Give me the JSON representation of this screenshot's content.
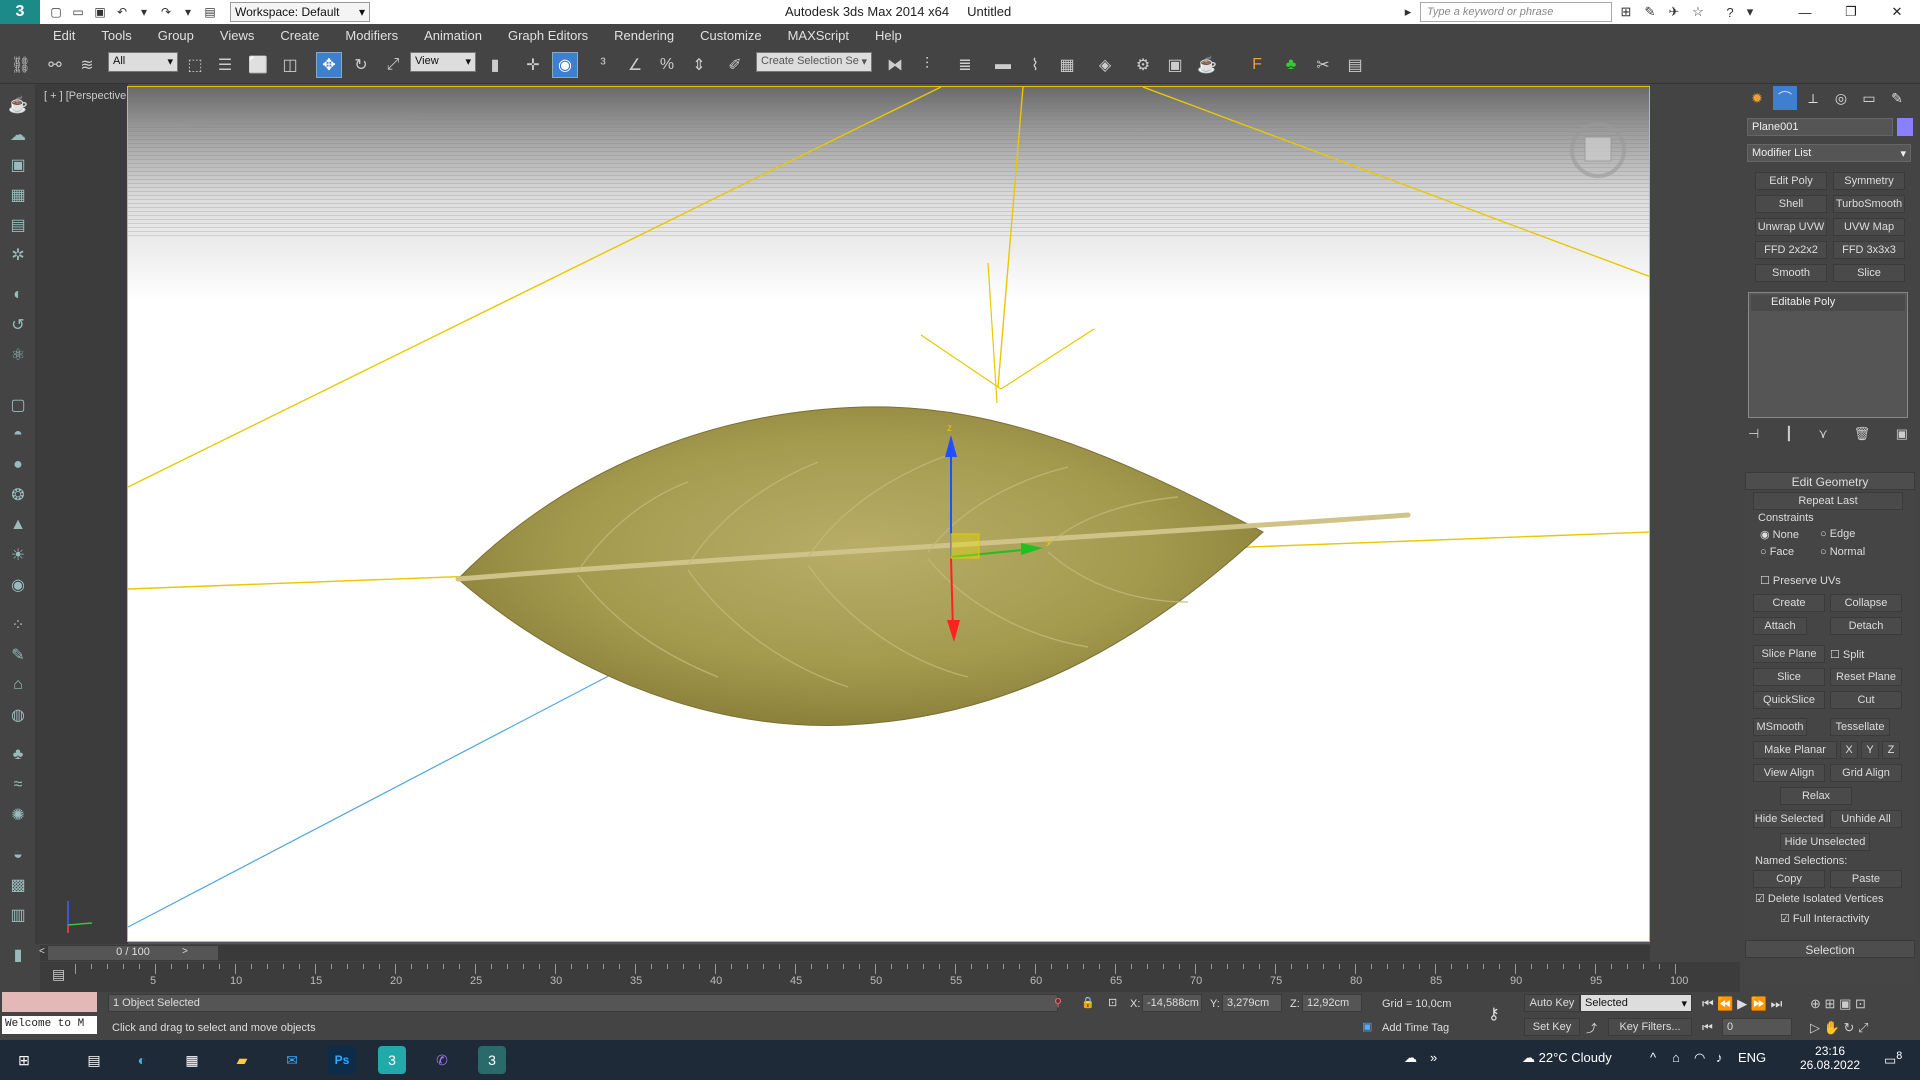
{
  "window": {
    "title": "Autodesk 3ds Max  2014 x64",
    "document": "Untitled",
    "workspace": "Workspace: Default",
    "search_placeholder": "Type a keyword or phrase"
  },
  "menu": [
    "Edit",
    "Tools",
    "Group",
    "Views",
    "Create",
    "Modifiers",
    "Animation",
    "Graph Editors",
    "Rendering",
    "Customize",
    "MAXScript",
    "Help"
  ],
  "toolbar": {
    "selection_filter": "All",
    "ref_coord": "View",
    "named_selection_placeholder": "Create Selection Se"
  },
  "viewport": {
    "label": "[ + ] [Perspective ] [Shaded + Edged Faces ]",
    "axis_x": "x",
    "axis_y": "y",
    "axis_z": "z"
  },
  "command_panel": {
    "object_name": "Plane001",
    "modifier_list": "Modifier List",
    "modifier_buttons": [
      "Edit Poly",
      "Symmetry",
      "Shell",
      "TurboSmooth",
      "Unwrap UVW",
      "UVW Map",
      "FFD 2x2x2",
      "FFD 3x3x3",
      "Smooth",
      "Slice"
    ],
    "stack_item": "Editable Poly"
  },
  "edit_geometry": {
    "title": "Edit Geometry",
    "repeat_last": "Repeat Last",
    "constraints": "Constraints",
    "none": "None",
    "edge": "Edge",
    "face": "Face",
    "normal": "Normal",
    "preserve_uvs": "Preserve UVs",
    "create": "Create",
    "collapse": "Collapse",
    "attach": "Attach",
    "detach": "Detach",
    "slice_plane": "Slice Plane",
    "split": "Split",
    "slice": "Slice",
    "reset_plane": "Reset Plane",
    "quickslice": "QuickSlice",
    "cut": "Cut",
    "msmooth": "MSmooth",
    "tessellate": "Tessellate",
    "make_planar": "Make Planar",
    "x": "X",
    "y": "Y",
    "z": "Z",
    "view_align": "View Align",
    "grid_align": "Grid Align",
    "relax": "Relax",
    "hide_selected": "Hide Selected",
    "unhide_all": "Unhide All",
    "hide_unselected": "Hide Unselected",
    "named_selections": "Named Selections:",
    "copy": "Copy",
    "paste": "Paste",
    "delete_isolated": "Delete Isolated Vertices",
    "full_interactivity": "Full Interactivity",
    "selection": "Selection"
  },
  "timeline": {
    "frame": "0 / 100",
    "ticks": [
      5,
      10,
      15,
      20,
      25,
      30,
      35,
      40,
      45,
      50,
      55,
      60,
      65,
      70,
      75,
      80,
      85,
      90,
      95,
      100
    ]
  },
  "status": {
    "selected": "1 Object Selected",
    "prompt": "Click and drag to select and move objects",
    "welcome": "Welcome to M",
    "x_label": "X:",
    "x": "-14,588cm",
    "y_label": "Y:",
    "y": "3,279cm",
    "z_label": "Z:",
    "z": "12,92cm",
    "grid": "Grid = 10,0cm",
    "auto_key": "Auto Key",
    "set_key": "Set Key",
    "key_mode": "Selected",
    "key_filters": "Key Filters...",
    "add_time_tag": "Add Time Tag",
    "current_frame": "0"
  },
  "taskbar": {
    "weather": "22°C  Cloudy",
    "lang": "ENG",
    "time": "23:16",
    "date": "26.08.2022",
    "notif_count": "8"
  }
}
